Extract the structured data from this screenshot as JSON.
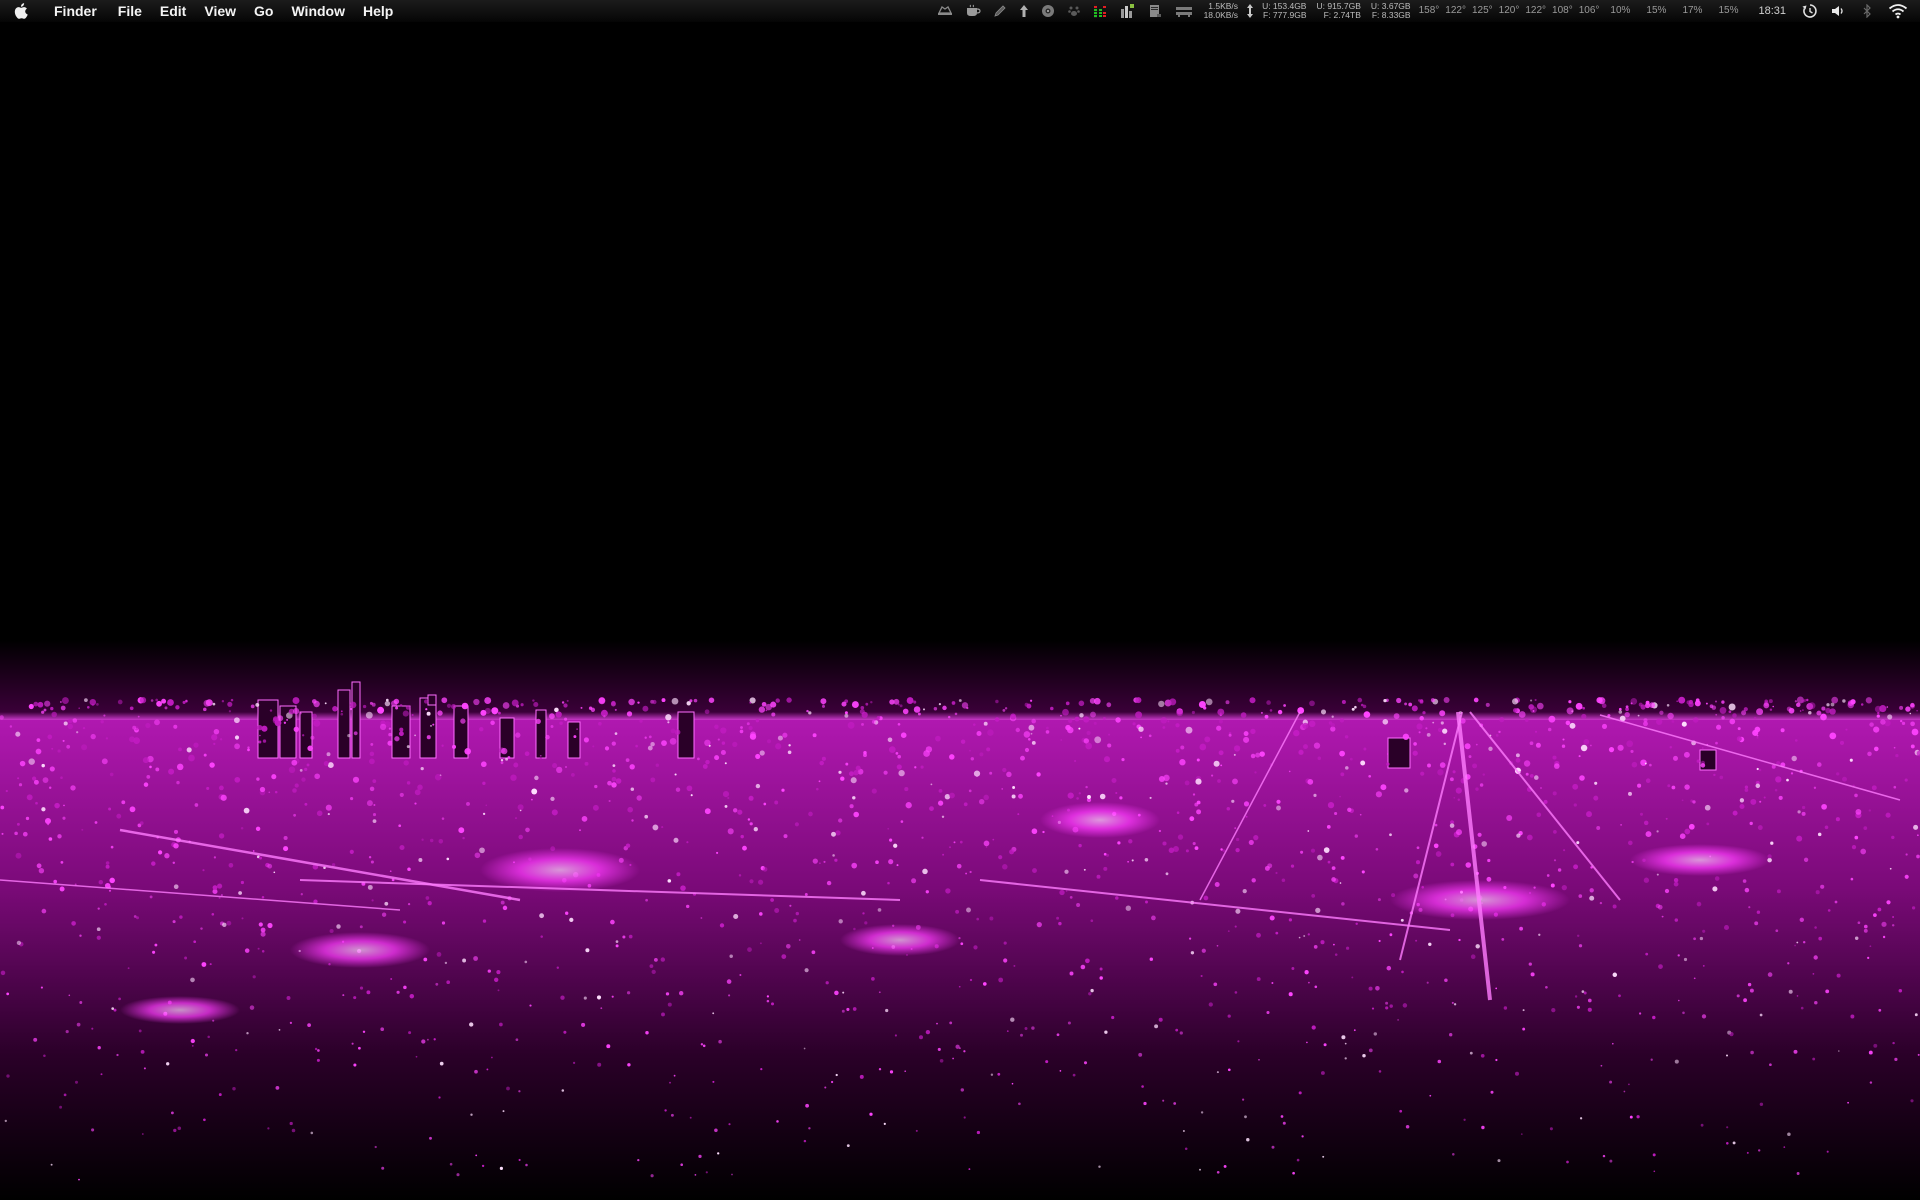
{
  "menubar": {
    "apple_icon": "apple-logo-icon",
    "app_name": "Finder",
    "menus": [
      "File",
      "Edit",
      "View",
      "Go",
      "Window",
      "Help"
    ],
    "status_icons": [
      "hat-icon",
      "coffee-cup-icon",
      "pen-icon",
      "upload-arrow-icon",
      "disk-icon",
      "paw-icon",
      "meter-bars-icon",
      "activity-monitor-icon",
      "printer-icon",
      "drive-icon"
    ],
    "network": {
      "upload": "1.5KB/s",
      "download": "18.0KB/s"
    },
    "transfer_icon": "up-down-arrow-icon",
    "disks": [
      {
        "used": "U: 153.4GB",
        "free": "F: 777.9GB"
      },
      {
        "used": "U: 915.7GB",
        "free": "F: 2.74TB"
      },
      {
        "used": "U: 3.67GB",
        "free": "F: 8.33GB"
      }
    ],
    "temperatures": [
      "158°",
      "122°",
      "125°",
      "120°",
      "122°",
      "108°",
      "106°"
    ],
    "cpu_loads": [
      "10%",
      "15%",
      "17%",
      "15%"
    ],
    "clock": "18:31",
    "right_icons": [
      "time-machine-icon",
      "volume-icon",
      "bluetooth-icon",
      "wifi-icon"
    ],
    "accent_color": "#ff22ff"
  },
  "wallpaper": {
    "description_color": "#e040e0",
    "sky_color": "#000000"
  }
}
